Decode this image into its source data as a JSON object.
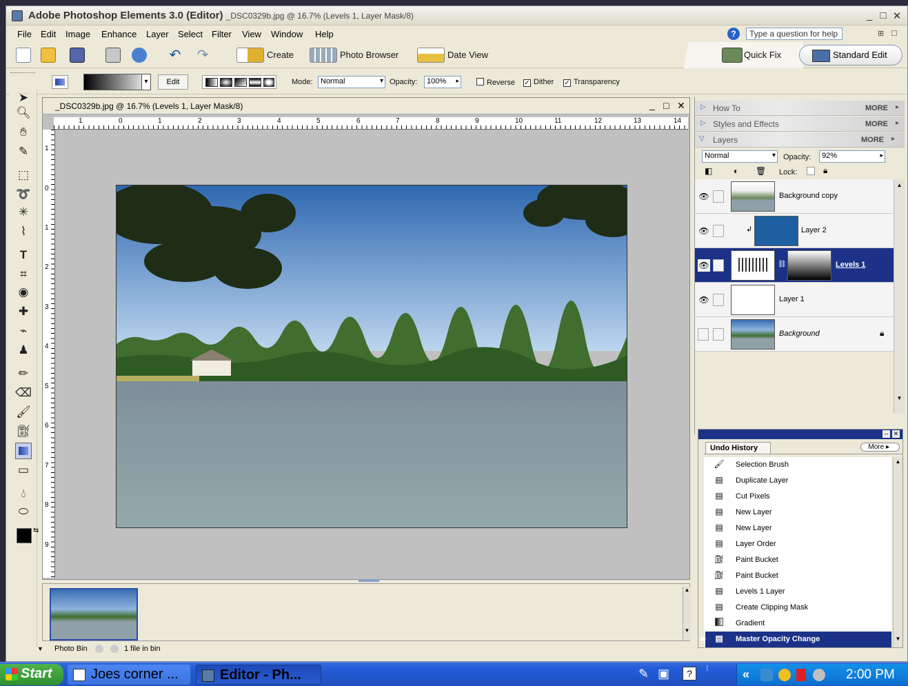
{
  "window": {
    "app_title": "Adobe Photoshop Elements 3.0 (Editor)",
    "doc_subtitle": "_DSC0329b.jpg @ 16.7% (Levels 1, Layer Mask/8)",
    "minimize": "_",
    "maximize": "□",
    "close": "✕"
  },
  "menu": {
    "items": [
      "File",
      "Edit",
      "Image",
      "Enhance",
      "Layer",
      "Select",
      "Filter",
      "View",
      "Window",
      "Help"
    ],
    "help_placeholder": "Type a question for help"
  },
  "shortcuts": {
    "create": "Create",
    "photo_browser": "Photo Browser",
    "date_view": "Date View",
    "quick_fix": "Quick Fix",
    "standard_edit": "Standard Edit"
  },
  "options": {
    "edit_button": "Edit",
    "mode_label": "Mode:",
    "mode_value": "Normal",
    "opacity_label": "Opacity:",
    "opacity_value": "100%",
    "reverse_label": "Reverse",
    "reverse_checked": false,
    "dither_label": "Dither",
    "dither_checked": true,
    "transparency_label": "Transparency",
    "transparency_checked": true
  },
  "document": {
    "title": "_DSC0329b.jpg @ 16.7% (Levels 1, Layer Mask/8)",
    "ruler_h_ticks": [
      "1",
      "0",
      "1",
      "2",
      "3",
      "4",
      "5",
      "6",
      "7",
      "8",
      "9",
      "10",
      "11",
      "12",
      "13",
      "14"
    ],
    "ruler_v_ticks": [
      "1",
      "0",
      "1",
      "2",
      "3",
      "4",
      "5",
      "6",
      "7",
      "8",
      "9"
    ]
  },
  "photo_bin": {
    "label": "Photo Bin",
    "count_text": "1 file in bin"
  },
  "palettes": {
    "how_to": "How To",
    "styles_effects": "Styles and Effects",
    "layers": "Layers",
    "more": "MORE",
    "blend_mode": "Normal",
    "opacity_label": "Opacity:",
    "opacity_value": "92%",
    "lock_label": "Lock:"
  },
  "layers": [
    {
      "name": "Background copy",
      "visible": true,
      "selected": false
    },
    {
      "name": "Layer 2",
      "visible": true,
      "selected": false
    },
    {
      "name": "Levels 1",
      "visible": true,
      "selected": true
    },
    {
      "name": "Layer 1",
      "visible": true,
      "selected": false
    },
    {
      "name": "Background",
      "visible": false,
      "selected": false
    }
  ],
  "undo_history": {
    "title": "Undo History",
    "more": "More",
    "items": [
      {
        "label": "Selection Brush",
        "icon": "brush-icon"
      },
      {
        "label": "Duplicate Layer",
        "icon": "history-state-icon"
      },
      {
        "label": "Cut Pixels",
        "icon": "history-state-icon"
      },
      {
        "label": "New Layer",
        "icon": "history-state-icon"
      },
      {
        "label": "New Layer",
        "icon": "history-state-icon"
      },
      {
        "label": "Layer Order",
        "icon": "history-state-icon"
      },
      {
        "label": "Paint Bucket",
        "icon": "paint-bucket-icon"
      },
      {
        "label": "Paint Bucket",
        "icon": "paint-bucket-icon"
      },
      {
        "label": "Levels 1 Layer",
        "icon": "history-state-icon"
      },
      {
        "label": "Create Clipping Mask",
        "icon": "history-state-icon"
      },
      {
        "label": "Gradient",
        "icon": "gradient-icon"
      },
      {
        "label": "Master Opacity Change",
        "icon": "history-state-icon"
      }
    ]
  },
  "taskbar": {
    "start": "Start",
    "task1": "Joes corner ...",
    "task2": "Editor - Ph...",
    "clock": "2:00 PM",
    "tray_chevron": "«"
  },
  "colors": {
    "selection_blue": "#1b3288",
    "layer2_fill": "#1d5fa0",
    "taskbar_blue": "#245edb"
  }
}
